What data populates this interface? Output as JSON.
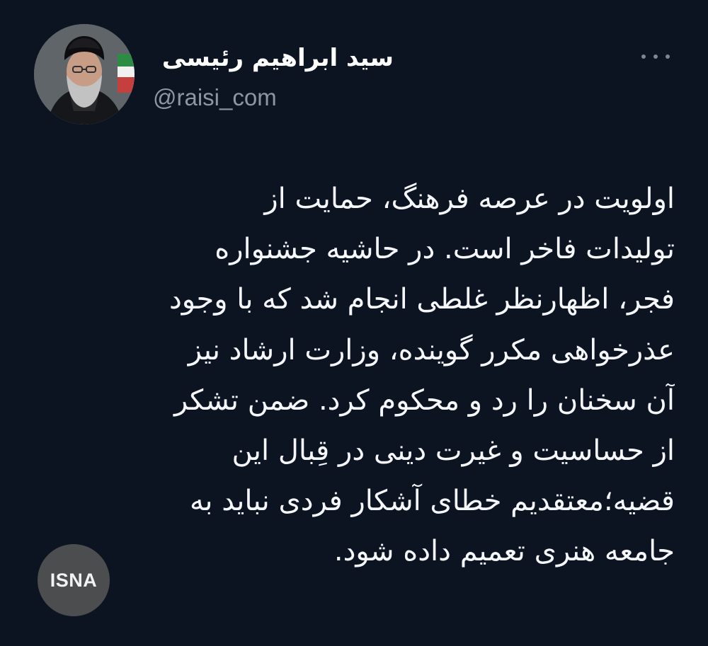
{
  "tweet": {
    "author": {
      "display_name": "سید ابراهیم رئیسی",
      "handle": "@raisi_com"
    },
    "more_icon": "more-horizontal-icon",
    "body_lines": [
      "اولویت در عرصه فرهنگ، حمایت از",
      "تولیدات فاخر است. در حاشیه جشنواره",
      "فجر، اظهارنظر غلطی انجام شد که با وجود",
      "عذرخواهی مکرر گوینده، وزارت ارشاد نیز",
      "آن سخنان را رد و محکوم کرد. ضمن تشکر",
      "از حساسیت و غیرت دینی در قِبال این",
      "قضیه؛معتقدیم خطای آشکار فردی نباید به",
      "جامعه هنری تعمیم داده شود."
    ]
  },
  "watermark": {
    "text": "ISNA"
  },
  "colors": {
    "background": "#0c1321",
    "text_primary": "#f5f7fb",
    "text_secondary": "#8d97a4",
    "watermark": "#4f5151"
  }
}
